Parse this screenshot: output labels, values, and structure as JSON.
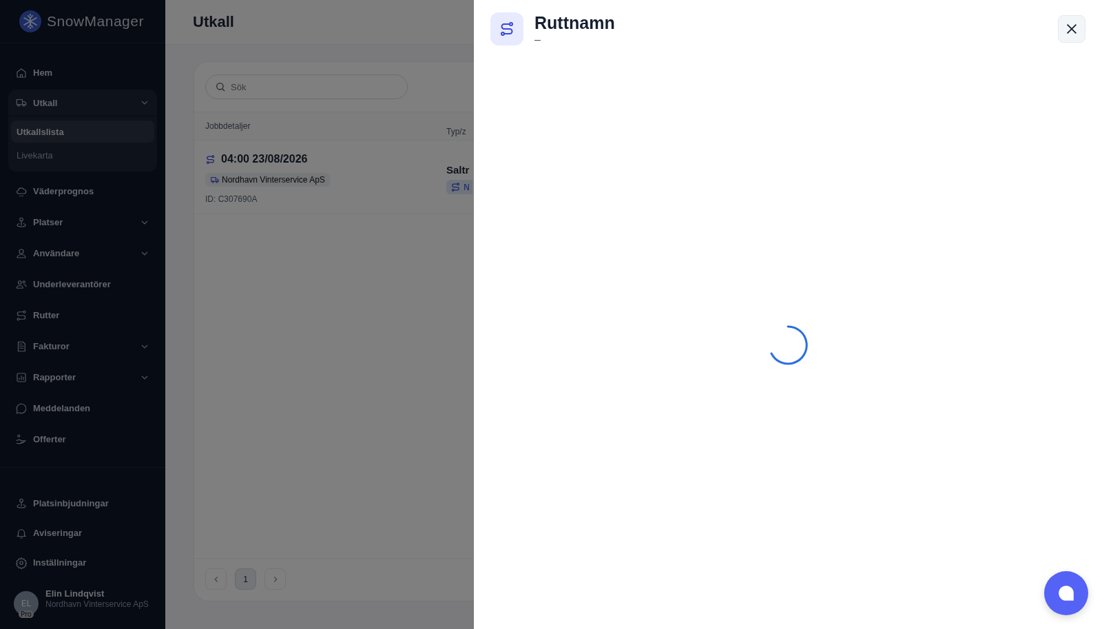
{
  "app": {
    "name": "SnowManager"
  },
  "sidebar": {
    "items": [
      {
        "label": "Hem",
        "kind": "link"
      },
      {
        "label": "Utkall",
        "kind": "submenu",
        "expanded": true,
        "children": [
          {
            "label": "Utkallslista",
            "selected": true
          },
          {
            "label": "Livekarta",
            "selected": false
          }
        ]
      },
      {
        "label": "Väderprognos",
        "kind": "link"
      },
      {
        "label": "Platser",
        "kind": "submenu",
        "expanded": false
      },
      {
        "label": "Användare",
        "kind": "submenu",
        "expanded": false
      },
      {
        "label": "Underleverantörer",
        "kind": "link"
      },
      {
        "label": "Rutter",
        "kind": "link"
      },
      {
        "label": "Fakturor",
        "kind": "submenu",
        "expanded": false
      },
      {
        "label": "Rapporter",
        "kind": "submenu",
        "expanded": false
      },
      {
        "label": "Meddelanden",
        "kind": "link"
      },
      {
        "label": "Offerter",
        "kind": "link"
      }
    ],
    "bottom_items": [
      {
        "label": "Platsinbjudningar"
      },
      {
        "label": "Aviseringar"
      },
      {
        "label": "Inställningar"
      }
    ],
    "user": {
      "name": "Elin Lindqvist",
      "company": "Nordhavn Vinterservice ApS",
      "initials": "EL",
      "badge": "Pro"
    }
  },
  "page": {
    "title": "Utkall",
    "search": {
      "placeholder": "Sök"
    },
    "table": {
      "columns": [
        "Jobbdetaljer",
        "Typ/z"
      ],
      "rows": [
        {
          "time": "04:00 23/08/2026",
          "company": "Nordhavn Vinterservice ApS",
          "id": "ID: C307690A",
          "column_2": "Saltr",
          "tag": "N"
        }
      ]
    },
    "pagination": {
      "pages": [
        {
          "label": "1",
          "selected": true
        }
      ]
    }
  },
  "drawer": {
    "title": "Ruttnamn",
    "subtitle": "–",
    "loading": true
  }
}
